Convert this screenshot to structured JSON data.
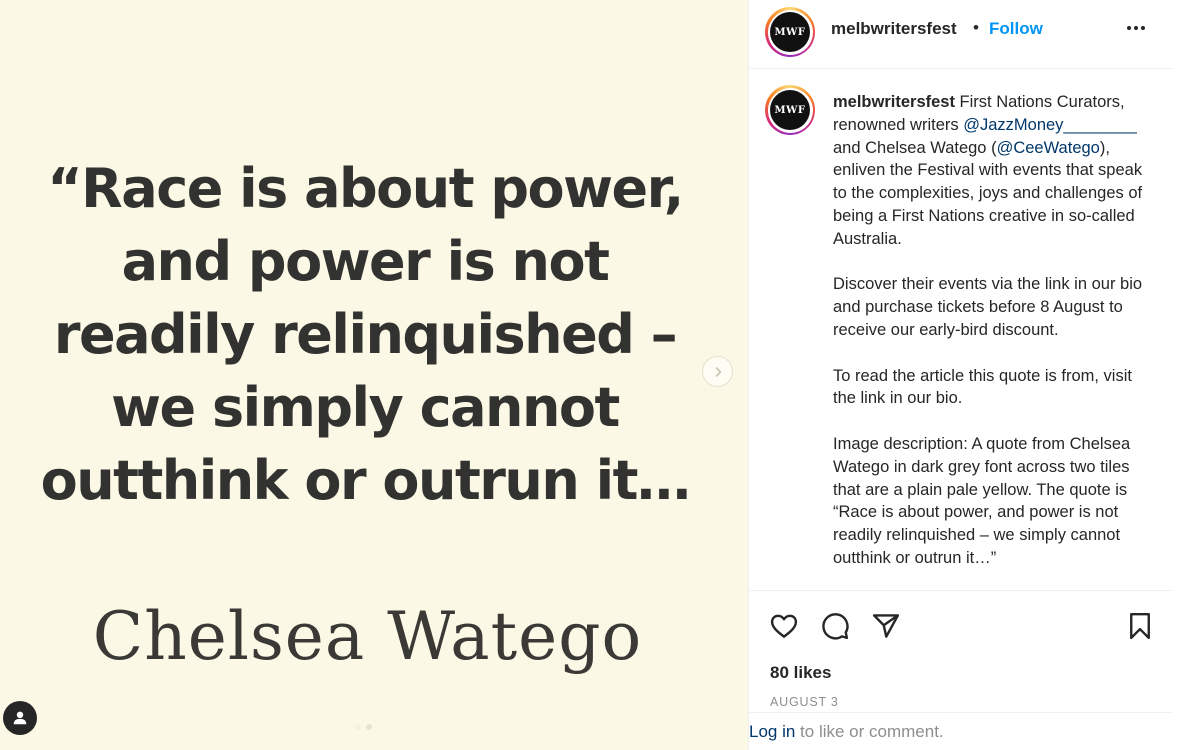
{
  "post": {
    "quote_lines": [
      "“Race is about power,",
      "and power is not",
      "readily relinquished –",
      "we simply cannot",
      "outthink or outrun it…"
    ],
    "author": "Chelsea Watego"
  },
  "header": {
    "avatar_text": "MWF",
    "username": "melbwritersfest",
    "separator": "•",
    "follow_label": "Follow"
  },
  "caption": {
    "username": "melbwritersfest",
    "para1_text1": " First Nations Curators, renowned writers ",
    "mention1": "@JazzMoney________",
    "para1_text2": " and Chelsea Watego (",
    "mention2": "@CeeWatego",
    "para1_text3": "), enliven the Festival with events that speak to the complexities, joys and challenges of being a First Nations creative in so-called Australia.",
    "para2": "Discover their events via the link in our bio and purchase tickets before 8 August to receive our early-bird discount.",
    "para3": "To read the article this quote is from, visit the link in our bio.",
    "para4": "Image description: A quote from Chelsea Watego in dark grey font across two tiles that are a plain pale yellow. The quote is “Race is about power, and power is not readily relinquished – we simply cannot outthink or outrun it…”"
  },
  "engagement": {
    "likes": "80 likes",
    "date": "AUGUST 3"
  },
  "login": {
    "link_text": "Log in",
    "rest_text": " to like or comment."
  },
  "colors": {
    "accent": "#0095f6",
    "media_background": "#fcf8e6",
    "quote_text": "#323230",
    "mention": "#00376b"
  },
  "icons": [
    "chevron-right-icon",
    "user-tag-icon",
    "heart-icon",
    "comment-icon",
    "share-icon",
    "bookmark-icon",
    "more-options-icon"
  ]
}
